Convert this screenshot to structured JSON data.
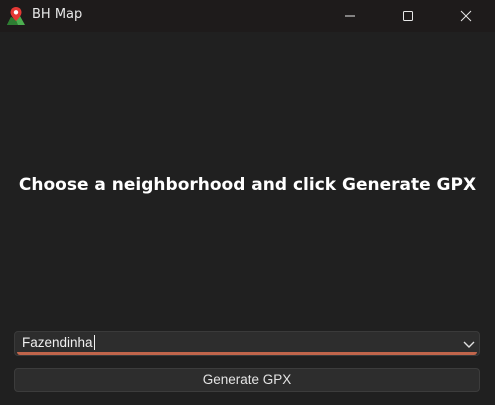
{
  "window": {
    "title": "BH Map",
    "icon": "map-pin-icon",
    "controls": {
      "minimize": "minimize-icon",
      "maximize": "maximize-icon",
      "close": "close-icon"
    }
  },
  "main": {
    "instruction": "Choose a neighborhood and click Generate GPX"
  },
  "neighborhood_select": {
    "value": "Fazendinha",
    "accent_color": "#c0654b"
  },
  "actions": {
    "generate_label": "Generate GPX"
  },
  "colors": {
    "background": "#202020",
    "titlebar": "#1e1b1b",
    "control": "#2d2d2d"
  }
}
